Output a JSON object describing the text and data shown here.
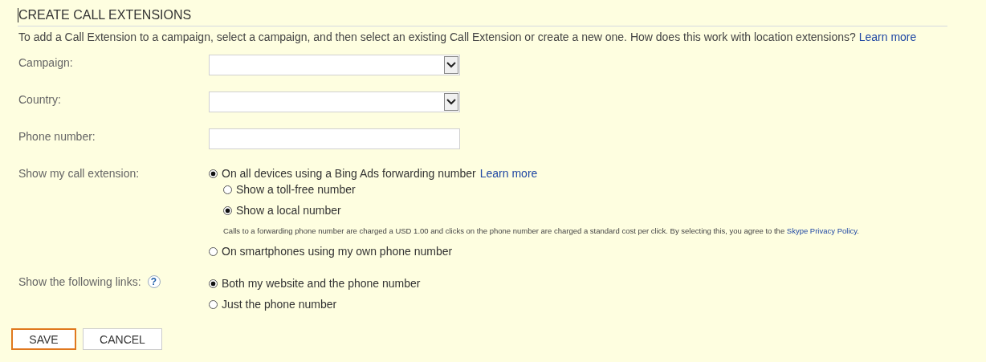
{
  "heading": "CREATE CALL EXTENSIONS",
  "intro": {
    "text": "To add a Call Extension to a campaign, select a campaign, and then select an existing Call Extension or create a new one. How does this work with location extensions?",
    "link": "Learn more"
  },
  "fields": [
    {
      "label": "Campaign:",
      "kind": "select"
    },
    {
      "label": "Country:",
      "kind": "select"
    },
    {
      "label": "Phone number:",
      "kind": "text"
    }
  ],
  "call_extension": {
    "label": "Show my call extension:",
    "options": [
      {
        "label": "On all devices using a Bing Ads forwarding number",
        "link": "Learn more",
        "selected": true,
        "children": [
          {
            "label": "Show a toll-free number",
            "selected": false
          },
          {
            "label": "Show a local number",
            "selected": true
          }
        ],
        "note": {
          "text": "Calls to a forwarding phone number are charged a USD 1.00 and clicks on the phone number are charged a standard cost per click. By selecting this, you agree to the",
          "link": "Skype Privacy Policy",
          "end": "."
        }
      },
      {
        "label": "On smartphones using my own phone number",
        "selected": false
      }
    ]
  },
  "links": {
    "label": "Show the following links:",
    "help": "?",
    "options": [
      {
        "label": "Both my website and the phone number",
        "selected": true
      },
      {
        "label": "Just the phone number",
        "selected": false
      }
    ]
  },
  "buttons": [
    {
      "label": "SAVE",
      "selected": true
    },
    {
      "label": "CANCEL",
      "selected": false
    }
  ]
}
